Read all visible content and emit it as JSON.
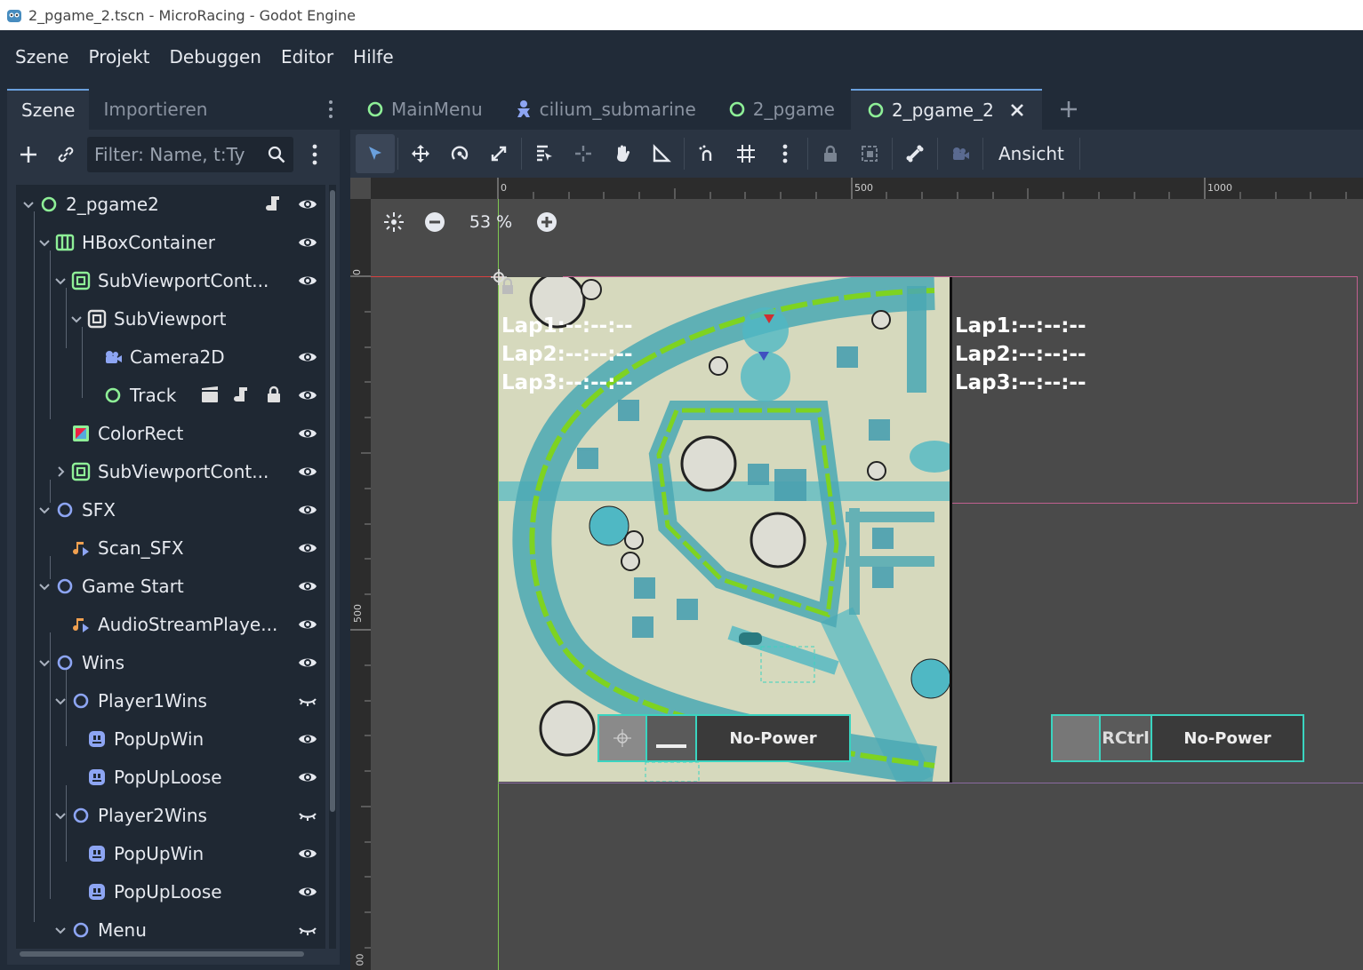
{
  "window": {
    "title": "2_pgame_2.tscn - MicroRacing - Godot Engine"
  },
  "menubar": {
    "items": [
      "Szene",
      "Projekt",
      "Debuggen",
      "Editor",
      "Hilfe"
    ]
  },
  "scene_dock": {
    "tabs": [
      "Szene",
      "Importieren"
    ],
    "filter_placeholder": "Filter: Name, t:Ty",
    "tree": [
      {
        "label": "2_pgame2",
        "icon": "node-icon",
        "eye": "visible"
      },
      {
        "label": "HBoxContainer",
        "icon": "hbox-icon",
        "eye": "visible"
      },
      {
        "label": "SubViewportCont...",
        "icon": "subviewport-container-icon",
        "eye": "visible"
      },
      {
        "label": "SubViewport",
        "icon": "subviewport-icon"
      },
      {
        "label": "Camera2D",
        "icon": "camera-icon",
        "eye": "visible"
      },
      {
        "label": "Track",
        "icon": "node-icon",
        "eye": "visible"
      },
      {
        "label": "ColorRect",
        "icon": "colorrect-icon",
        "eye": "visible"
      },
      {
        "label": "SubViewportCont...",
        "icon": "subviewport-container-icon",
        "eye": "visible"
      },
      {
        "label": "SFX",
        "icon": "node-icon",
        "eye": "visible"
      },
      {
        "label": "Scan_SFX",
        "icon": "audio-icon",
        "eye": "visible"
      },
      {
        "label": "Game Start",
        "icon": "node-icon",
        "eye": "visible"
      },
      {
        "label": "AudioStreamPlaye...",
        "icon": "audio-icon",
        "eye": "visible"
      },
      {
        "label": "Wins",
        "icon": "node-icon",
        "eye": "visible"
      },
      {
        "label": "Player1Wins",
        "icon": "node-icon",
        "eye": "hidden"
      },
      {
        "label": "PopUpWin",
        "icon": "popup-icon",
        "eye": "visible"
      },
      {
        "label": "PopUpLoose",
        "icon": "popup-icon",
        "eye": "visible"
      },
      {
        "label": "Player2Wins",
        "icon": "node-icon",
        "eye": "hidden"
      },
      {
        "label": "PopUpWin",
        "icon": "popup-icon",
        "eye": "visible"
      },
      {
        "label": "PopUpLoose",
        "icon": "popup-icon",
        "eye": "visible"
      },
      {
        "label": "Menu",
        "icon": "node-icon",
        "eye": "hidden"
      }
    ]
  },
  "scene_tabs": [
    {
      "label": "MainMenu",
      "icon": "node-icon"
    },
    {
      "label": "cilium_submarine",
      "icon": "character-icon"
    },
    {
      "label": "2_pgame",
      "icon": "node-icon"
    },
    {
      "label": "2_pgame_2",
      "icon": "node-icon",
      "active": true
    }
  ],
  "toolbar": {
    "view_label": "Ansicht"
  },
  "ruler": {
    "top_labels": [
      "0",
      "500",
      "1000"
    ],
    "left_labels": [
      "0",
      "500",
      "00"
    ]
  },
  "canvas": {
    "zoom": "53 %",
    "left_laps": [
      "Lap1:--:--:--",
      "Lap2:--:--:--",
      "Lap3:--:--:--"
    ],
    "right_laps": [
      "Lap1:--:--:--",
      "Lap2:--:--:--",
      "Lap3:--:--:--"
    ],
    "hud_left": {
      "power": "No-Power"
    },
    "hud_right": {
      "key": "RCtrl",
      "power": "No-Power"
    }
  },
  "colors": {
    "accent": "#6aa0dd",
    "node_green": "#8eef97",
    "node_blue": "#8da5f3",
    "hud_border": "#3ad4c0",
    "track_bg": "#d9dcc0",
    "track_green": "#7ed321",
    "water": "#4fb8c4"
  }
}
